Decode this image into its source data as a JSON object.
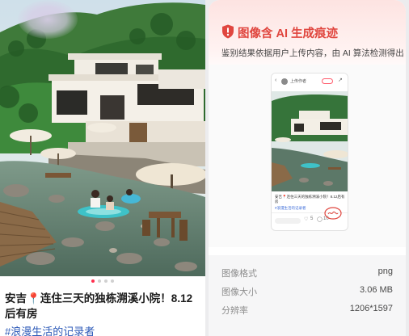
{
  "post": {
    "title_prefix": "安吉",
    "pin_glyph": "📍",
    "title_rest": "连住三天的独栋溯溪小院！8.12后有房",
    "tag": "#浪漫生活的记录者",
    "carousel": {
      "count": 4,
      "active_index": 0
    }
  },
  "panel": {
    "title": "图像含 AI 生成痕迹",
    "subtitle": "鉴别结果依据用户上传内容，由 AI 算法检测得出",
    "accent_color": "#e0463f",
    "preview": {
      "user_name": "上传作者",
      "caption": "安吉📍连住三天的独栋溯溪小院！8.12后有房",
      "tag": "#浪漫生活的记录者",
      "comment_count": "5",
      "like_count": "10"
    },
    "info": [
      {
        "label": "图像格式",
        "value": "png"
      },
      {
        "label": "图像大小",
        "value": "3.06 MB"
      },
      {
        "label": "分辨率",
        "value": "1206*1597"
      }
    ]
  }
}
